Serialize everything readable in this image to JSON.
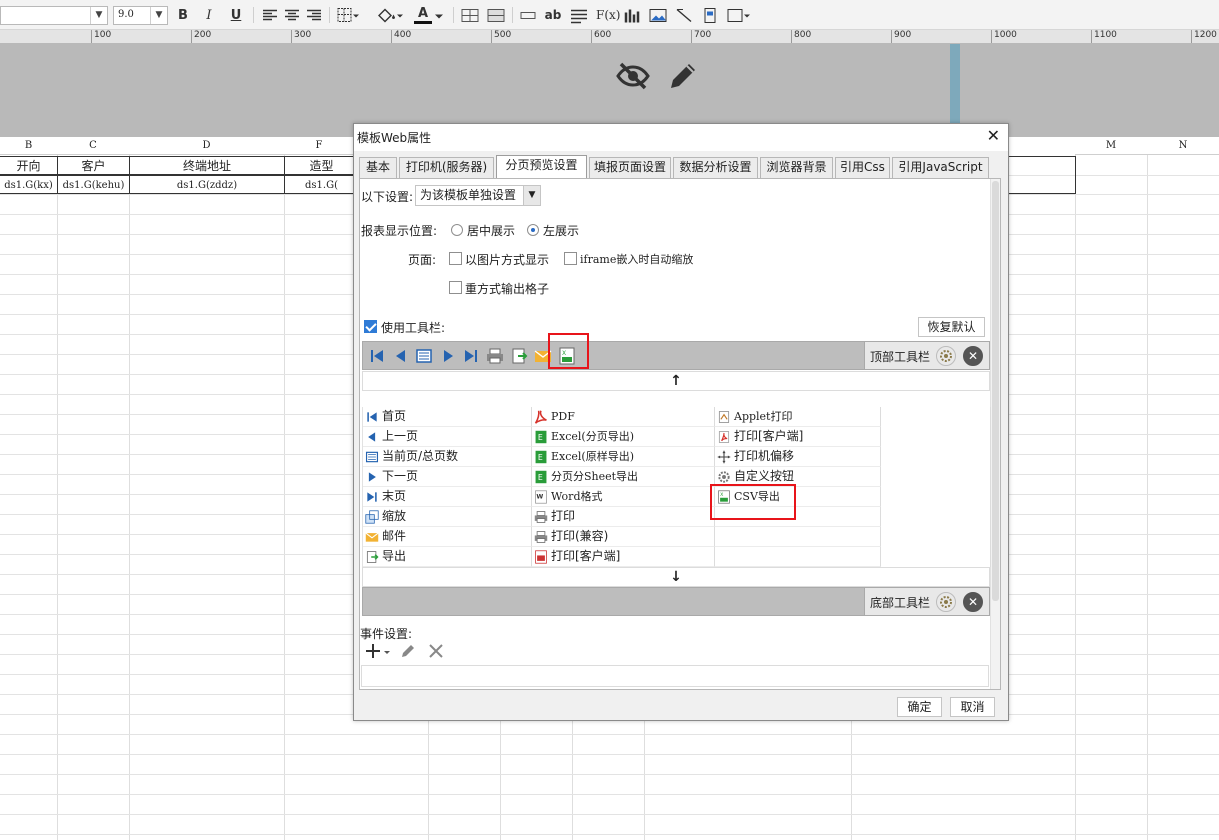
{
  "toolbar": {
    "font_size": "9.0",
    "bold": "B",
    "italic": "I",
    "underline": "U",
    "text_tool": "ab",
    "formula": "F(x)",
    "font_color_label": "A"
  },
  "ruler": {
    "labels": [
      "100",
      "200",
      "300",
      "400",
      "500",
      "600",
      "700",
      "800",
      "900",
      "1000",
      "1100",
      "1200"
    ]
  },
  "sheet": {
    "columns": [
      "B",
      "C",
      "D",
      "F",
      "M",
      "N"
    ],
    "header_row": [
      "开向",
      "客户",
      "终端地址",
      "造型"
    ],
    "data_row": [
      "ds1.G(kx)",
      "ds1.G(kehu)",
      "ds1.G(zddz)",
      "ds1.G("
    ]
  },
  "dialog": {
    "title": "模板Web属性",
    "tabs": [
      "基本",
      "打印机(服务器)",
      "分页预览设置",
      "填报页面设置",
      "数据分析设置",
      "浏览器背景",
      "引用Css",
      "引用JavaScript"
    ],
    "active_tab": "分页预览设置",
    "settings_label": "以下设置:",
    "settings_value": "为该模板单独设置",
    "display_position_label": "报表显示位置:",
    "radio_center": "居中展示",
    "radio_left": "左展示",
    "page_label": "页面:",
    "check_image": "以图片方式显示",
    "check_iframe": "iframe嵌入时自动缩放",
    "check_repeat": "重方式输出格子",
    "use_toolbar": "使用工具栏:",
    "restore_default": "恢复默认",
    "top_toolbar": "顶部工具栏",
    "bottom_toolbar": "底部工具栏",
    "arrow_up": "↑",
    "arrow_down": "↓",
    "grid": {
      "col1": [
        "首页",
        "上一页",
        "当前页/总页数",
        "下一页",
        "末页",
        "缩放",
        "邮件",
        "导出"
      ],
      "col2": [
        "PDF",
        "Excel(分页导出)",
        "Excel(原样导出)",
        "分页分Sheet导出",
        "Word格式",
        "打印",
        "打印(兼容)",
        "打印[客户端]"
      ],
      "col3": [
        "Applet打印",
        "打印[客户端]",
        "打印机偏移",
        "自定义按钮",
        "CSV导出"
      ]
    },
    "event_label": "事件设置:",
    "ok": "确定",
    "cancel": "取消"
  },
  "colors": {
    "accent": "#2f7bd6",
    "highlight": "#e8141a",
    "banner": "#b9b9b9",
    "banner_bar": "#7ea9bb"
  }
}
